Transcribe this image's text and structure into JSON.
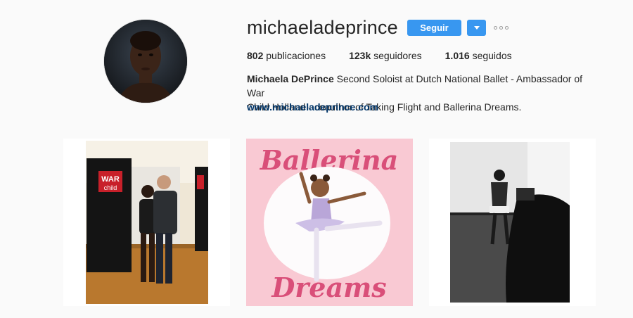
{
  "profile": {
    "username": "michaeladeprince",
    "follow_label": "Seguir",
    "stats": {
      "posts_count": "802",
      "posts_label": "publicaciones",
      "followers_count": "123k",
      "followers_label": "seguidores",
      "following_count": "1.016",
      "following_label": "seguidos"
    },
    "bio_name": "Michaela DePrince",
    "bio_line1": " Second Soloist at Dutch National Ballet - Ambassador of War",
    "bio_line2": "Child Holland - coauthor of Taking Flight and Ballerina Dreams.",
    "website": "www.michaeladeprince.com"
  },
  "posts": [
    {
      "sign_top": "WAR",
      "sign_bottom": "child"
    },
    {
      "book_title_top": "Ballerina",
      "book_title_bottom": "Dreams"
    },
    {}
  ],
  "colors": {
    "accent": "#3897f0",
    "link": "#003569",
    "book_pink": "#f9c9d3",
    "book_title": "#d94f79"
  }
}
